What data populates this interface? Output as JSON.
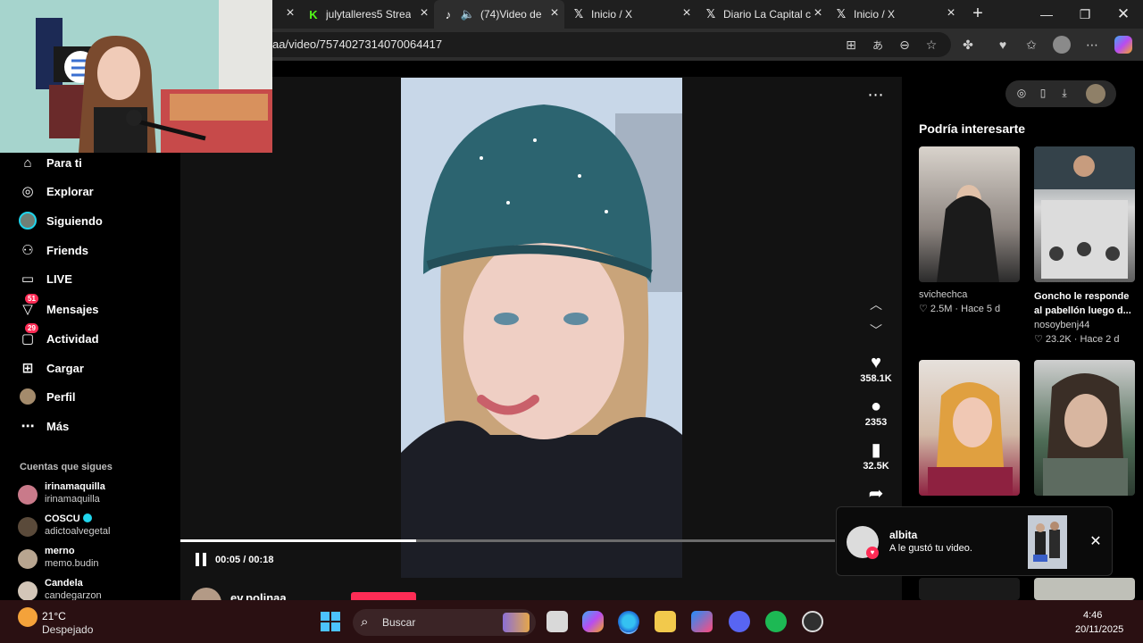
{
  "browser": {
    "tabs": [
      {
        "label": "julytalleres5 Strea",
        "icon": "kick-icon"
      },
      {
        "label": "(74)Video de",
        "icon": "tiktok-icon"
      },
      {
        "label": "Inicio / X",
        "icon": "x-icon"
      },
      {
        "label": "Diario La Capital c",
        "icon": "x-icon"
      },
      {
        "label": "Inicio / X",
        "icon": "x-icon"
      }
    ],
    "new_tab_symbol": "+",
    "url": "aa/video/7574027314070064417"
  },
  "sidebar": {
    "items": [
      {
        "label": "Para ti",
        "icon": "home-icon"
      },
      {
        "label": "Explorar",
        "icon": "compass-icon"
      },
      {
        "label": "Siguiendo",
        "icon": "following-icon"
      },
      {
        "label": "Friends",
        "icon": "friends-icon"
      },
      {
        "label": "LIVE",
        "icon": "live-icon"
      },
      {
        "label": "Mensajes",
        "icon": "message-icon",
        "badge": "51"
      },
      {
        "label": "Actividad",
        "icon": "activity-icon",
        "badge": "29"
      },
      {
        "label": "Cargar",
        "icon": "upload-icon"
      },
      {
        "label": "Perfil",
        "icon": "profile-icon"
      },
      {
        "label": "Más",
        "icon": "more-icon"
      }
    ],
    "following_title": "Cuentas que sigues",
    "accounts": [
      {
        "name": "irinamaquilla",
        "handle": "irinamaquilla"
      },
      {
        "name": "COSCU",
        "handle": "adictoalvegetal"
      },
      {
        "name": "merno",
        "handle": "memo.budin"
      },
      {
        "name": "Candela",
        "handle": "candegarzon"
      }
    ]
  },
  "player": {
    "likes": "358.1K",
    "comments": "2353",
    "saves": "32.5K",
    "time": "00:05 / 00:18",
    "progress": 0.36,
    "author": "ev.polinaa"
  },
  "recommendations": {
    "title": "Podría interesarte",
    "items": [
      {
        "author": "svichechca",
        "caption": "",
        "stats": "2.5M · Hace 5 d"
      },
      {
        "author": "nosoybenj44",
        "caption": "Goncho le responde al pabellón luego d...",
        "stats": "23.2K · Hace 2 d"
      }
    ]
  },
  "notification": {
    "name": "albita",
    "message": "A le gustó tu video."
  },
  "taskbar": {
    "temperature": "21°C",
    "weather": "Despejado",
    "search_placeholder": "Buscar",
    "time": "4:46",
    "date": "20/11/2025"
  },
  "colors": {
    "accent": "#fe2c55",
    "verified": "#20d5ec",
    "taskbar": "#2a1012"
  }
}
